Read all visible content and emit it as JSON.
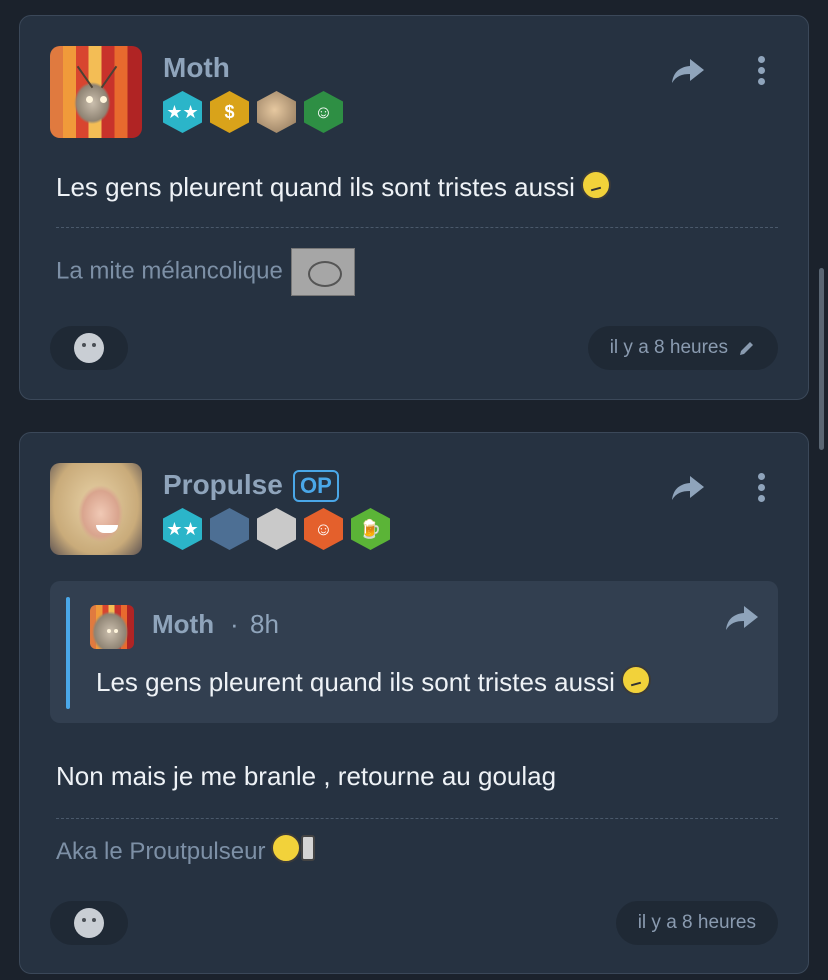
{
  "posts": [
    {
      "author": "Moth",
      "body": "Les gens pleurent quand ils sont tristes aussi",
      "signature": "La mite mélancolique",
      "time": "il y a 8 heures",
      "badges": [
        "two-stars",
        "dollar",
        "photo",
        "santa"
      ]
    },
    {
      "author": "Propulse",
      "op_label": "OP",
      "badges": [
        "two-stars",
        "photo",
        "photo",
        "smiley",
        "beer"
      ],
      "quote": {
        "author": "Moth",
        "separator": "·",
        "time": "8h",
        "body": "Les gens pleurent quand ils sont tristes aussi"
      },
      "body": "Non mais je me branle , retourne au goulag",
      "signature": "Aka le Proutpulseur",
      "time": "il y a 8 heures"
    }
  ],
  "icons": {
    "share": "share-arrow",
    "more": "vertical-dots",
    "edit": "pencil",
    "reaction": "add-reaction-face"
  },
  "colors": {
    "background": "#1b222c",
    "card": "#263241",
    "accent": "#4aa7e8",
    "username": "#8fa4bb"
  }
}
